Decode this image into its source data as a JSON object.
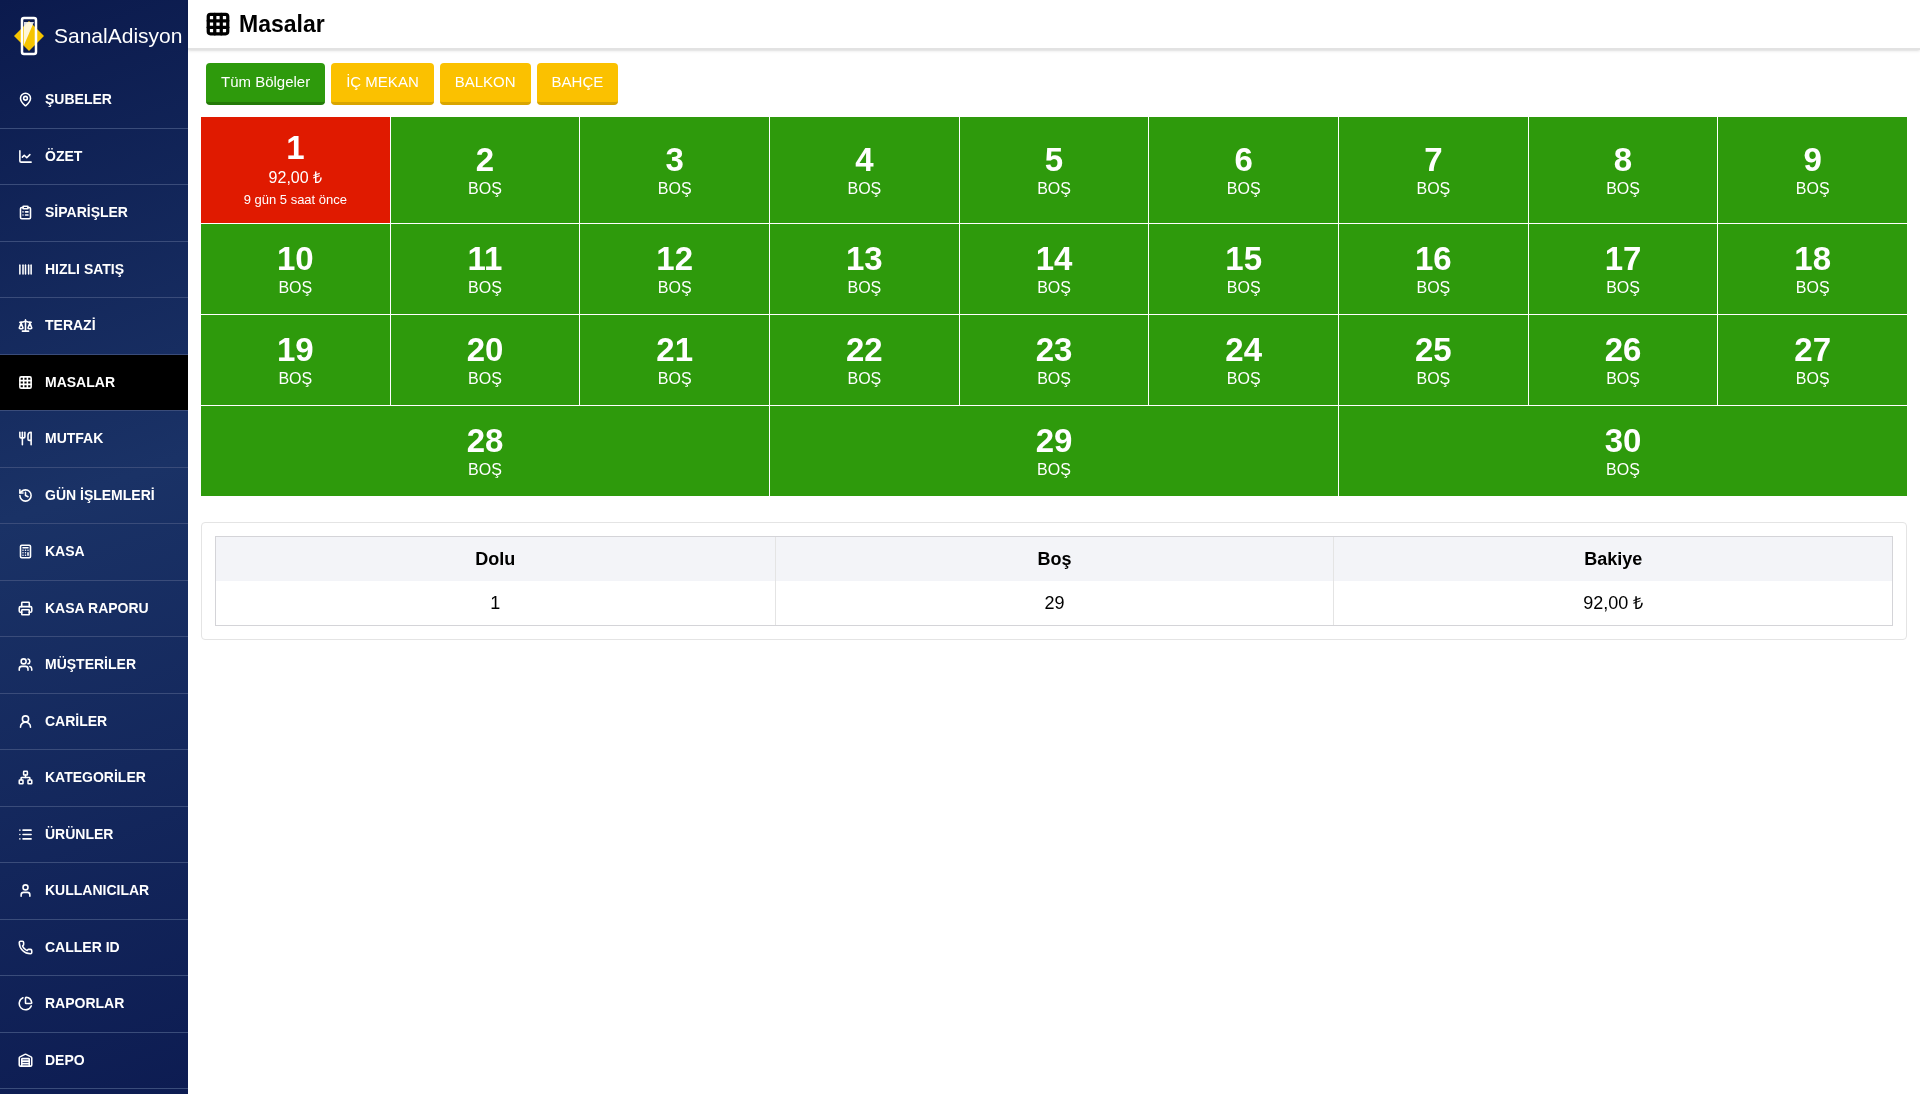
{
  "brand": "SanalAdisyon",
  "sidebar": {
    "items": [
      {
        "label": "ŞUBELER",
        "selected": false
      },
      {
        "label": "ÖZET",
        "selected": false
      },
      {
        "label": "SİPARİŞLER",
        "selected": false
      },
      {
        "label": "HIZLI SATIŞ",
        "selected": false
      },
      {
        "label": "TERAZİ",
        "selected": false
      },
      {
        "label": "MASALAR",
        "selected": true
      },
      {
        "label": "MUTFAK",
        "selected": false
      },
      {
        "label": "GÜN İŞLEMLERİ",
        "selected": false
      },
      {
        "label": "KASA",
        "selected": false
      },
      {
        "label": "KASA RAPORU",
        "selected": false
      },
      {
        "label": "MÜŞTERİLER",
        "selected": false
      },
      {
        "label": "CARİLER",
        "selected": false
      },
      {
        "label": "KATEGORİLER",
        "selected": false
      },
      {
        "label": "ÜRÜNLER",
        "selected": false
      },
      {
        "label": "KULLANICILAR",
        "selected": false
      },
      {
        "label": "CALLER ID",
        "selected": false
      },
      {
        "label": "RAPORLAR",
        "selected": false
      },
      {
        "label": "DEPO",
        "selected": false
      }
    ]
  },
  "page_title": "Masalar",
  "regions": [
    {
      "label": "Tüm Bölgeler",
      "selected": true
    },
    {
      "label": "İÇ MEKAN",
      "selected": false
    },
    {
      "label": "BALKON",
      "selected": false
    },
    {
      "label": "BAHÇE",
      "selected": false
    }
  ],
  "table_rows": [
    [
      {
        "number": "1",
        "occupied": true,
        "amount": "92,00 ₺",
        "time": "9 gün 5 saat önce"
      },
      {
        "number": "2",
        "occupied": false,
        "status": "BOŞ"
      },
      {
        "number": "3",
        "occupied": false,
        "status": "BOŞ"
      },
      {
        "number": "4",
        "occupied": false,
        "status": "BOŞ"
      },
      {
        "number": "5",
        "occupied": false,
        "status": "BOŞ"
      },
      {
        "number": "6",
        "occupied": false,
        "status": "BOŞ"
      },
      {
        "number": "7",
        "occupied": false,
        "status": "BOŞ"
      },
      {
        "number": "8",
        "occupied": false,
        "status": "BOŞ"
      },
      {
        "number": "9",
        "occupied": false,
        "status": "BOŞ"
      }
    ],
    [
      {
        "number": "10",
        "occupied": false,
        "status": "BOŞ"
      },
      {
        "number": "11",
        "occupied": false,
        "status": "BOŞ"
      },
      {
        "number": "12",
        "occupied": false,
        "status": "BOŞ"
      },
      {
        "number": "13",
        "occupied": false,
        "status": "BOŞ"
      },
      {
        "number": "14",
        "occupied": false,
        "status": "BOŞ"
      },
      {
        "number": "15",
        "occupied": false,
        "status": "BOŞ"
      },
      {
        "number": "16",
        "occupied": false,
        "status": "BOŞ"
      },
      {
        "number": "17",
        "occupied": false,
        "status": "BOŞ"
      },
      {
        "number": "18",
        "occupied": false,
        "status": "BOŞ"
      }
    ],
    [
      {
        "number": "19",
        "occupied": false,
        "status": "BOŞ"
      },
      {
        "number": "20",
        "occupied": false,
        "status": "BOŞ"
      },
      {
        "number": "21",
        "occupied": false,
        "status": "BOŞ"
      },
      {
        "number": "22",
        "occupied": false,
        "status": "BOŞ"
      },
      {
        "number": "23",
        "occupied": false,
        "status": "BOŞ"
      },
      {
        "number": "24",
        "occupied": false,
        "status": "BOŞ"
      },
      {
        "number": "25",
        "occupied": false,
        "status": "BOŞ"
      },
      {
        "number": "26",
        "occupied": false,
        "status": "BOŞ"
      },
      {
        "number": "27",
        "occupied": false,
        "status": "BOŞ"
      }
    ],
    [
      {
        "number": "28",
        "occupied": false,
        "status": "BOŞ"
      },
      {
        "number": "29",
        "occupied": false,
        "status": "BOŞ"
      },
      {
        "number": "30",
        "occupied": false,
        "status": "BOŞ"
      }
    ]
  ],
  "summary": {
    "columns": [
      "Dolu",
      "Boş",
      "Bakiye"
    ],
    "values": [
      "1",
      "29",
      "92,00 ₺"
    ]
  }
}
